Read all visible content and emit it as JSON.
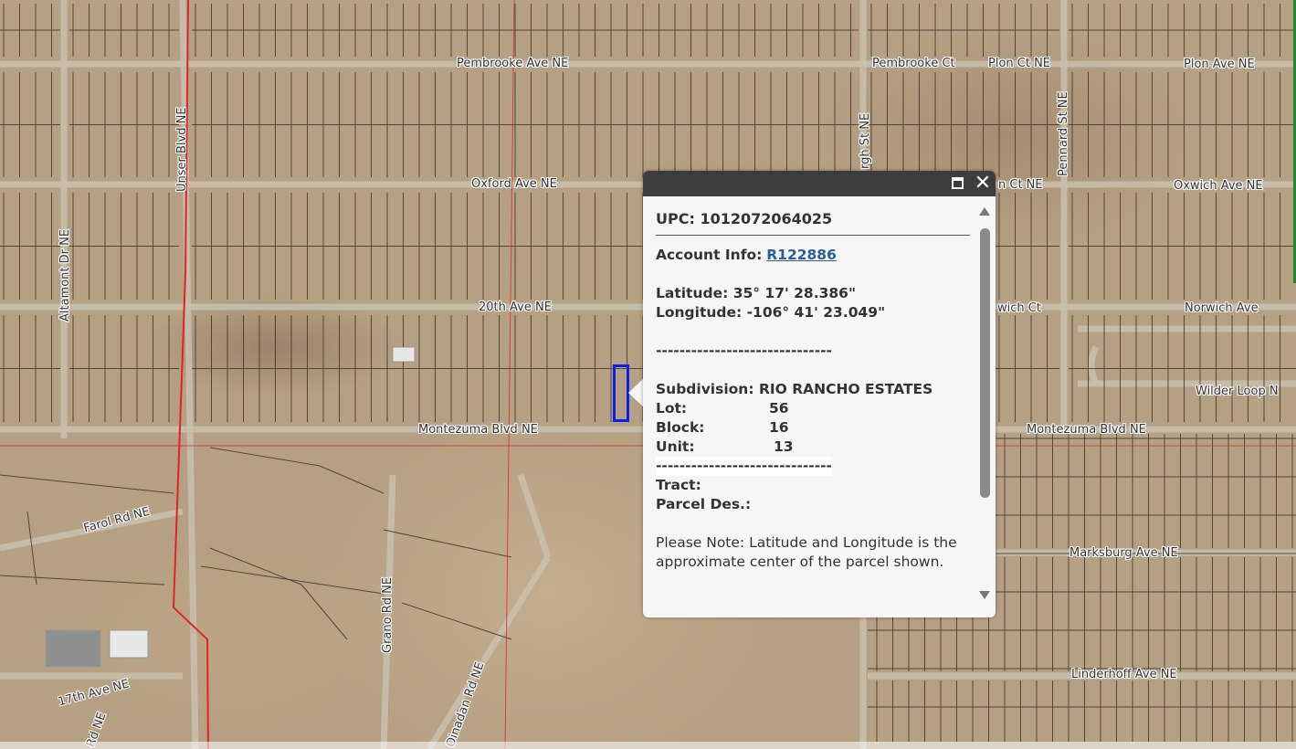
{
  "streets": {
    "pembrooke_ave": "Pembrooke Ave NE",
    "pembrooke_ct": "Pembrooke Ct",
    "plon_ct": "Plon Ct NE",
    "plon_ave": "Plon Ave NE",
    "oxford_ave": "Oxford Ave NE",
    "partial_ct_ne": "n Ct NE",
    "oxwich_ave": "Oxwich Ave NE",
    "twentieth_ave": "20th Ave NE",
    "partial_wich_ct": "wich Ct",
    "norwich_ave": "Norwich Ave",
    "wilder_loop": "Wilder Loop N",
    "montezuma_blvd_left": "Montezuma Blvd NE",
    "montezuma_blvd_right": "Montezuma Blvd NE",
    "farol_rd": "Farol Rd NE",
    "marksburg_ave": "Marksburg Ave NE",
    "linderhoff_ave": "Linderhoff Ave NE",
    "seventeenth_ave": "17th Ave NE",
    "unser_blvd": "Unser Blvd NE",
    "altamont_dr": "Altamont Dr NE",
    "partial_rgh_st": "rgh St NE",
    "pennard_st": "Pennard St NE",
    "grano_rd": "Grano Rd NE",
    "orzada_rd": "Oinadan Rd NE",
    "partial_rd": "Rd NE"
  },
  "popup": {
    "upc_label": "UPC:",
    "upc_value": "1012072064025",
    "account_label": "Account Info:",
    "account_value": "R122886",
    "latitude_label": "Latitude:",
    "latitude_value": "35° 17' 28.386\"",
    "longitude_label": "Longitude:",
    "longitude_value": "-106° 41' 23.049\"",
    "separator": "------------------------------",
    "subdivision_label": "Subdivision:",
    "subdivision_value": "RIO RANCHO ESTATES",
    "lot_label": "Lot:",
    "lot_value": "56",
    "block_label": "Block:",
    "block_value": "16",
    "unit_label": "Unit:",
    "unit_value": "13",
    "tract_label": "Tract:",
    "parcel_des_label": "Parcel Des.:",
    "note": "Please Note: Latitude and Longitude is the approximate center of the parcel shown.",
    "close_glyph": "✕"
  },
  "colors": {
    "parcel_highlight": "#0a1ff0",
    "boundary_red": "#e0242a",
    "link": "#2a5e9b"
  }
}
